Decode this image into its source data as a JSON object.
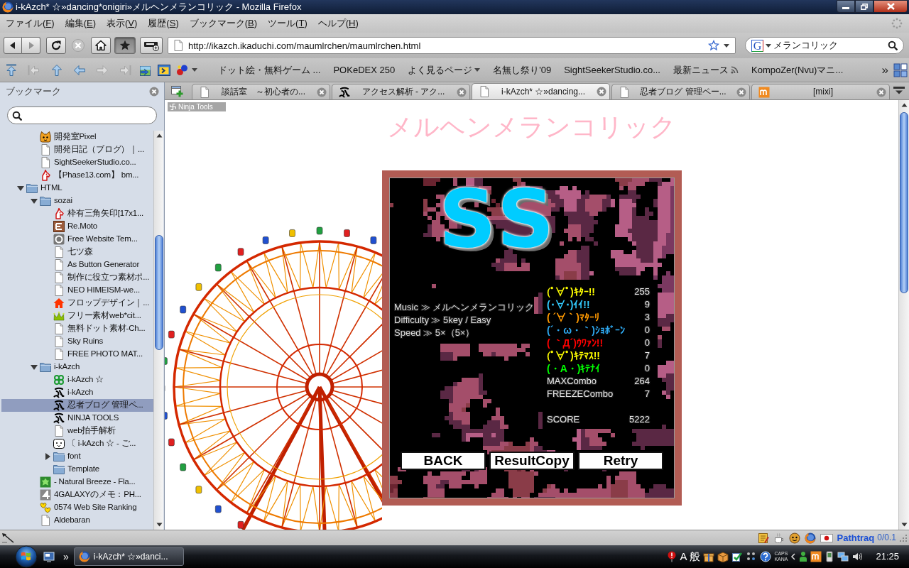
{
  "window": {
    "title": "i-kAzch* ☆»dancing*onigiri»メルヘンメランコリック - Mozilla Firefox"
  },
  "menu": [
    "ファイル(F)",
    "編集(E)",
    "表示(V)",
    "履歴(S)",
    "ブックマーク(B)",
    "ツール(T)",
    "ヘルプ(H)"
  ],
  "toolbar": {
    "buttons": [
      {
        "kind": "back",
        "disabled": false,
        "pressed": false
      },
      {
        "kind": "forward",
        "disabled": true,
        "pressed": false
      },
      {
        "kind": "reload",
        "disabled": false,
        "pressed": false
      },
      {
        "kind": "stop",
        "disabled": true,
        "pressed": false
      },
      {
        "kind": "home",
        "disabled": false,
        "pressed": false
      },
      {
        "kind": "bookmarks",
        "disabled": false,
        "pressed": true
      },
      {
        "kind": "device",
        "disabled": false,
        "pressed": false
      }
    ],
    "address": {
      "value": "http://ikazch.ikaduchi.com/maumlrchen/maumlrchen.html"
    },
    "search": {
      "engine": "G",
      "value": "メランコリック"
    }
  },
  "bookmarks_toolbar": {
    "icons": [
      {
        "kind": "top",
        "disabled": false
      },
      {
        "kind": "first",
        "disabled": true
      },
      {
        "kind": "up",
        "disabled": false
      },
      {
        "kind": "prev",
        "disabled": false
      },
      {
        "kind": "next",
        "disabled": true
      },
      {
        "kind": "last",
        "disabled": true
      },
      {
        "kind": "picture",
        "disabled": false
      },
      {
        "kind": "window",
        "disabled": false
      },
      {
        "kind": "balls",
        "disabled": false
      }
    ],
    "items": [
      {
        "label": "ドット絵・無料ゲーム ...",
        "kind": "link"
      },
      {
        "label": "POKeDEX 250",
        "kind": "link"
      },
      {
        "label": "よく見るページ",
        "kind": "folder"
      },
      {
        "label": "名無し祭り'09",
        "kind": "link"
      },
      {
        "label": "SightSeekerStudio.co...",
        "kind": "link"
      },
      {
        "label": "最新ニュース",
        "kind": "feed"
      },
      {
        "label": "KompoZer(Nvu)マニ...",
        "kind": "link"
      }
    ],
    "overflow": "»"
  },
  "sidebar": {
    "title": "ブックマーク",
    "tree": [
      {
        "children": [
          {
            "label": "開発室Pixel",
            "kind": "cat",
            "selected": false
          },
          {
            "label": "開発日記（ブログ）｜...",
            "kind": "page",
            "selected": false
          },
          {
            "label": "SightSeekerStudio.co...",
            "kind": "page",
            "selected": false
          },
          {
            "label": "【Phase13.com】 bm...",
            "kind": "horse",
            "selected": false
          }
        ]
      },
      {
        "label": "HTML",
        "kind": "folder",
        "expanded": true,
        "empty": false,
        "selected": false,
        "children": [
          {
            "label": "sozai",
            "kind": "folder",
            "expanded": true,
            "empty": false,
            "selected": false,
            "children": [
              {
                "label": "枠有三角矢印[17x1...",
                "kind": "horse",
                "selected": false
              },
              {
                "label": "Re.Moto",
                "kind": "tile",
                "selected": false
              },
              {
                "label": "Free Website Tem...",
                "kind": "ring",
                "selected": false
              },
              {
                "label": "七ツ森",
                "kind": "page",
                "selected": false
              },
              {
                "label": "As Button Generator",
                "kind": "page",
                "selected": false
              },
              {
                "label": "制作に役立つ素材ポ...",
                "kind": "page",
                "selected": false
              },
              {
                "label": "NEO HIMEISM-we...",
                "kind": "page",
                "selected": false
              },
              {
                "label": "フロップデザイン｜...",
                "kind": "house",
                "selected": false
              },
              {
                "label": "フリー素材web*cit...",
                "kind": "crown",
                "selected": false
              },
              {
                "label": "無料ドット素材-Ch...",
                "kind": "page",
                "selected": false
              },
              {
                "label": "Sky Ruins",
                "kind": "page",
                "selected": false
              },
              {
                "label": "FREE PHOTO MAT...",
                "kind": "page",
                "selected": false
              }
            ]
          },
          {
            "label": "i-kAzch",
            "kind": "folder",
            "expanded": true,
            "empty": false,
            "selected": false,
            "children": [
              {
                "label": "i-kAzch ☆",
                "kind": "clover",
                "selected": false
              },
              {
                "label": "i-kAzch",
                "kind": "brush",
                "selected": false
              },
              {
                "label": "忍者ブログ 管理ペ...",
                "kind": "brush",
                "selected": true
              },
              {
                "label": "NINJA TOOLS",
                "kind": "brush",
                "selected": false
              },
              {
                "label": "web拍手解析",
                "kind": "page",
                "selected": false
              },
              {
                "label": "〔 i-kAzch ☆ - ご...",
                "kind": "face",
                "selected": false
              },
              {
                "label": "font",
                "kind": "folder",
                "expanded": false,
                "empty": false,
                "selected": false
              },
              {
                "label": "Template",
                "kind": "folder",
                "empty": true,
                "selected": false
              }
            ]
          },
          {
            "label": "- Natural Breeze - Fla...",
            "kind": "leaf",
            "selected": false
          },
          {
            "label": "4GALAXYのメモ：PH...",
            "kind": "triangle",
            "selected": false
          },
          {
            "label": "0574 Web Site Ranking",
            "kind": "hearts",
            "selected": false
          },
          {
            "label": "Aldebaran",
            "kind": "page",
            "selected": false
          }
        ]
      }
    ]
  },
  "tabs": [
    {
      "label": "談話室　～初心者の...",
      "kind": "page",
      "selected": false
    },
    {
      "label": "アクセス解析 - アク...",
      "kind": "brush",
      "selected": false
    },
    {
      "label": "i-kAzch* ☆»dancing...",
      "kind": "page",
      "selected": true
    },
    {
      "label": "忍者ブログ 管理ペー...",
      "kind": "page",
      "selected": false
    },
    {
      "label": "[mixi]",
      "kind": "letter",
      "selected": false
    }
  ],
  "page": {
    "badge": "Ninja Tools",
    "heading": "メルヘンメランコリック",
    "result": {
      "rank": "SS",
      "info": [
        "Music ≫ メルヘンメランコリック",
        "Difficulty ≫ 5key / Easy",
        "Speed ≫ 5×（5×）"
      ],
      "judgments": [
        {
          "label": "(ﾟ∀ﾟ)ｷﾀｰ!!",
          "value": "255",
          "color": "#ffff00"
        },
        {
          "label": "(・∀・)ｲｲ!!",
          "value": "9",
          "color": "#33ccff"
        },
        {
          "label": "( ´∀｀)ﾏﾀｰﾘ",
          "value": "3",
          "color": "#ff9900"
        },
        {
          "label": "(´・ω・｀)ｼｮﾎﾞｰﾝ",
          "value": "0",
          "color": "#2ea8f0"
        },
        {
          "label": "( ｀Д´)ｳﾜｧﾝ!!",
          "value": "0",
          "color": "#ff0000"
        },
        {
          "label": "(ﾟ∀ﾟ)ｷﾃﾏｽ!!",
          "value": "7",
          "color": "#ffff00"
        },
        {
          "label": "(・A・)ｷﾃﾅｲ",
          "value": "0",
          "color": "#00ff00"
        }
      ],
      "combos": [
        {
          "label": "MAXCombo",
          "value": "264"
        },
        {
          "label": "FREEZECombo",
          "value": "7"
        }
      ],
      "score": {
        "label": "SCORE",
        "value": "5222"
      },
      "buttons": [
        "BACK",
        "ResultCopy",
        "Retry"
      ]
    }
  },
  "status_bar": {
    "addon_name": "Pathtraq",
    "addon_reading": "0/0.1"
  },
  "taskbar": {
    "overflow": "»",
    "task": "i-kAzch* ☆»danci...",
    "ime_mode": "A",
    "ime_dictionary": "般",
    "caps": "CAPS",
    "kana": "KANA",
    "clock": "21:25"
  }
}
